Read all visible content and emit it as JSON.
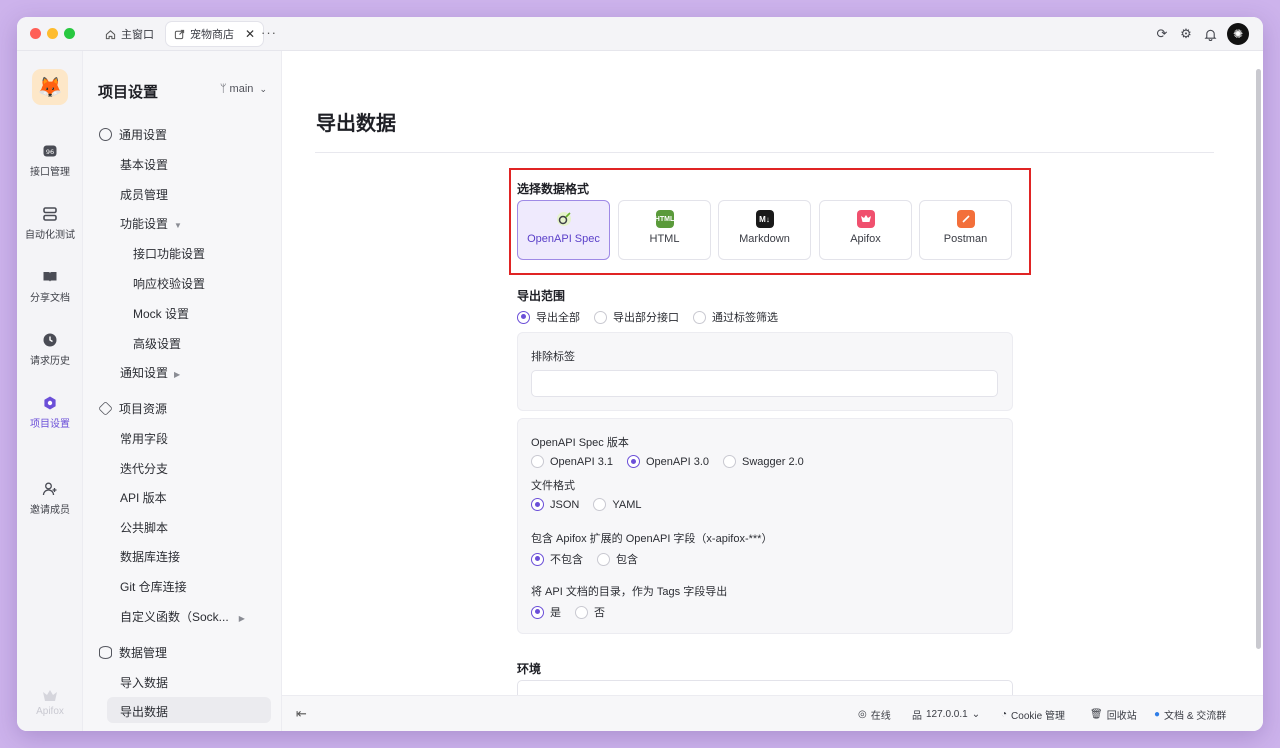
{
  "titlebar": {
    "tabs": [
      {
        "label": "主窗口",
        "icon": "home-icon"
      },
      {
        "label": "宠物商店",
        "icon": "external-link-icon"
      }
    ],
    "more": "···"
  },
  "rail": {
    "items": [
      {
        "label": "接口管理",
        "icon": "api-icon"
      },
      {
        "label": "自动化测试",
        "icon": "automation-icon"
      },
      {
        "label": "分享文档",
        "icon": "book-icon"
      },
      {
        "label": "请求历史",
        "icon": "clock-icon"
      },
      {
        "label": "项目设置",
        "icon": "settings-hexagon-icon",
        "active": true
      },
      {
        "label": "邀请成员",
        "icon": "add-user-icon"
      }
    ],
    "brand": "Apifox"
  },
  "sidebar": {
    "title": "项目设置",
    "branch": "main",
    "groups": {
      "general": "通用设置",
      "resources": "项目资源",
      "data": "数据管理"
    },
    "items": {
      "basic": "基本设置",
      "members": "成员管理",
      "features": "功能设置",
      "api_features": "接口功能设置",
      "response_validation": "响应校验设置",
      "mock": "Mock 设置",
      "advanced": "高级设置",
      "notify": "通知设置",
      "fields": "常用字段",
      "sprint": "迭代分支",
      "api_version": "API 版本",
      "scripts": "公共脚本",
      "db": "数据库连接",
      "git": "Git 仓库连接",
      "custom_func": "自定义函数（Sock...",
      "import": "导入数据",
      "export": "导出数据"
    }
  },
  "main": {
    "title": "导出数据",
    "format_label": "选择数据格式",
    "formats": [
      {
        "label": "OpenAPI Spec",
        "selected": true,
        "color": "#e6f3cc"
      },
      {
        "label": "HTML",
        "selected": false,
        "color": "#5a9a3a"
      },
      {
        "label": "Markdown",
        "selected": false,
        "color": "#1a1a1a"
      },
      {
        "label": "Apifox",
        "selected": false,
        "color": "#f0506e"
      },
      {
        "label": "Postman",
        "selected": false,
        "color": "#f36f3a"
      }
    ],
    "html_badge": "HTML",
    "md_badge": "M↓",
    "scope_label": "导出范围",
    "scope_options": [
      "导出全部",
      "导出部分接口",
      "通过标签筛选"
    ],
    "exclude_label": "排除标签",
    "spec_version_label": "OpenAPI Spec 版本",
    "spec_versions": [
      "OpenAPI 3.1",
      "OpenAPI 3.0",
      "Swagger 2.0"
    ],
    "file_format_label": "文件格式",
    "file_formats": [
      "JSON",
      "YAML"
    ],
    "ext_label": "包含 Apifox 扩展的 OpenAPI 字段（x-apifox-***）",
    "ext_options": [
      "不包含",
      "包含"
    ],
    "tags_label": "将 API 文档的目录，作为 Tags 字段导出",
    "tags_options": [
      "是",
      "否"
    ],
    "env_label": "环境"
  },
  "statusbar": {
    "online": "在线",
    "host": "127.0.0.1",
    "cookie": "Cookie 管理",
    "trash": "回收站",
    "docs": "文档 & 交流群"
  },
  "colors": {
    "accent": "#6b4fd8",
    "highlight": "#e02424"
  }
}
